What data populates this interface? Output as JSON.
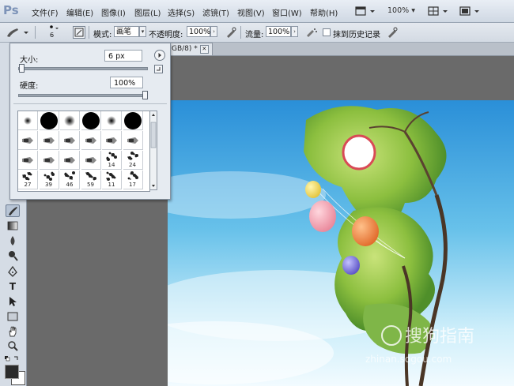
{
  "app": {
    "logo": "Ps"
  },
  "menu": [
    {
      "label": "文件(F)"
    },
    {
      "label": "编辑(E)"
    },
    {
      "label": "图像(I)"
    },
    {
      "label": "图层(L)"
    },
    {
      "label": "选择(S)"
    },
    {
      "label": "滤镜(T)"
    },
    {
      "label": "视图(V)"
    },
    {
      "label": "窗口(W)"
    },
    {
      "label": "帮助(H)"
    }
  ],
  "menu_right": {
    "zoom": "100%",
    "dropdown_glyph": "▾"
  },
  "options": {
    "brush_size_label": "6",
    "mode_label": "模式:",
    "mode_value": "画笔",
    "opacity_label": "不透明度:",
    "opacity_value": "100%",
    "flow_label": "流量:",
    "flow_value": "100%",
    "history_label": "抹到历史记录"
  },
  "doc_tab": {
    "title": "GB/8) *",
    "close": "✕"
  },
  "brush_panel": {
    "size_label": "大小:",
    "size_value": "6 px",
    "hardness_label": "硬度:",
    "hardness_value": "100%",
    "size_fraction": 0.0,
    "hardness_fraction": 1.0,
    "presets": [
      {
        "kind": "soft",
        "size": 10,
        "num": ""
      },
      {
        "kind": "hard",
        "size": 22,
        "num": ""
      },
      {
        "kind": "soft",
        "size": 14,
        "num": ""
      },
      {
        "kind": "hard",
        "size": 22,
        "num": ""
      },
      {
        "kind": "soft",
        "size": 12,
        "num": ""
      },
      {
        "kind": "hard",
        "size": 22,
        "num": ""
      },
      {
        "kind": "tip",
        "num": ""
      },
      {
        "kind": "tip",
        "num": ""
      },
      {
        "kind": "tip",
        "num": ""
      },
      {
        "kind": "tip",
        "num": ""
      },
      {
        "kind": "tip",
        "num": ""
      },
      {
        "kind": "tip",
        "num": ""
      },
      {
        "kind": "tip",
        "num": ""
      },
      {
        "kind": "tip",
        "num": ""
      },
      {
        "kind": "tip",
        "num": ""
      },
      {
        "kind": "tip",
        "num": ""
      },
      {
        "kind": "splat",
        "num": "14"
      },
      {
        "kind": "splat",
        "num": "24"
      },
      {
        "kind": "splat",
        "num": "27"
      },
      {
        "kind": "splat",
        "num": "39"
      },
      {
        "kind": "splat",
        "num": "46"
      },
      {
        "kind": "splat",
        "num": "59"
      },
      {
        "kind": "splat",
        "num": "11"
      },
      {
        "kind": "splat",
        "num": "17"
      }
    ]
  },
  "toolbar_tools": [
    "brush-tool",
    "gradient-tool",
    "blur-tool",
    "dodge-tool",
    "pen-tool",
    "type-tool",
    "path-select-tool",
    "shape-tool",
    "hand-tool",
    "zoom-tool"
  ],
  "watermark": {
    "text": "搜狗指南",
    "sub": "zhinan.sogou.com"
  },
  "colors": {
    "accent": "#4aa3df",
    "panel": "#e6ebf1"
  }
}
